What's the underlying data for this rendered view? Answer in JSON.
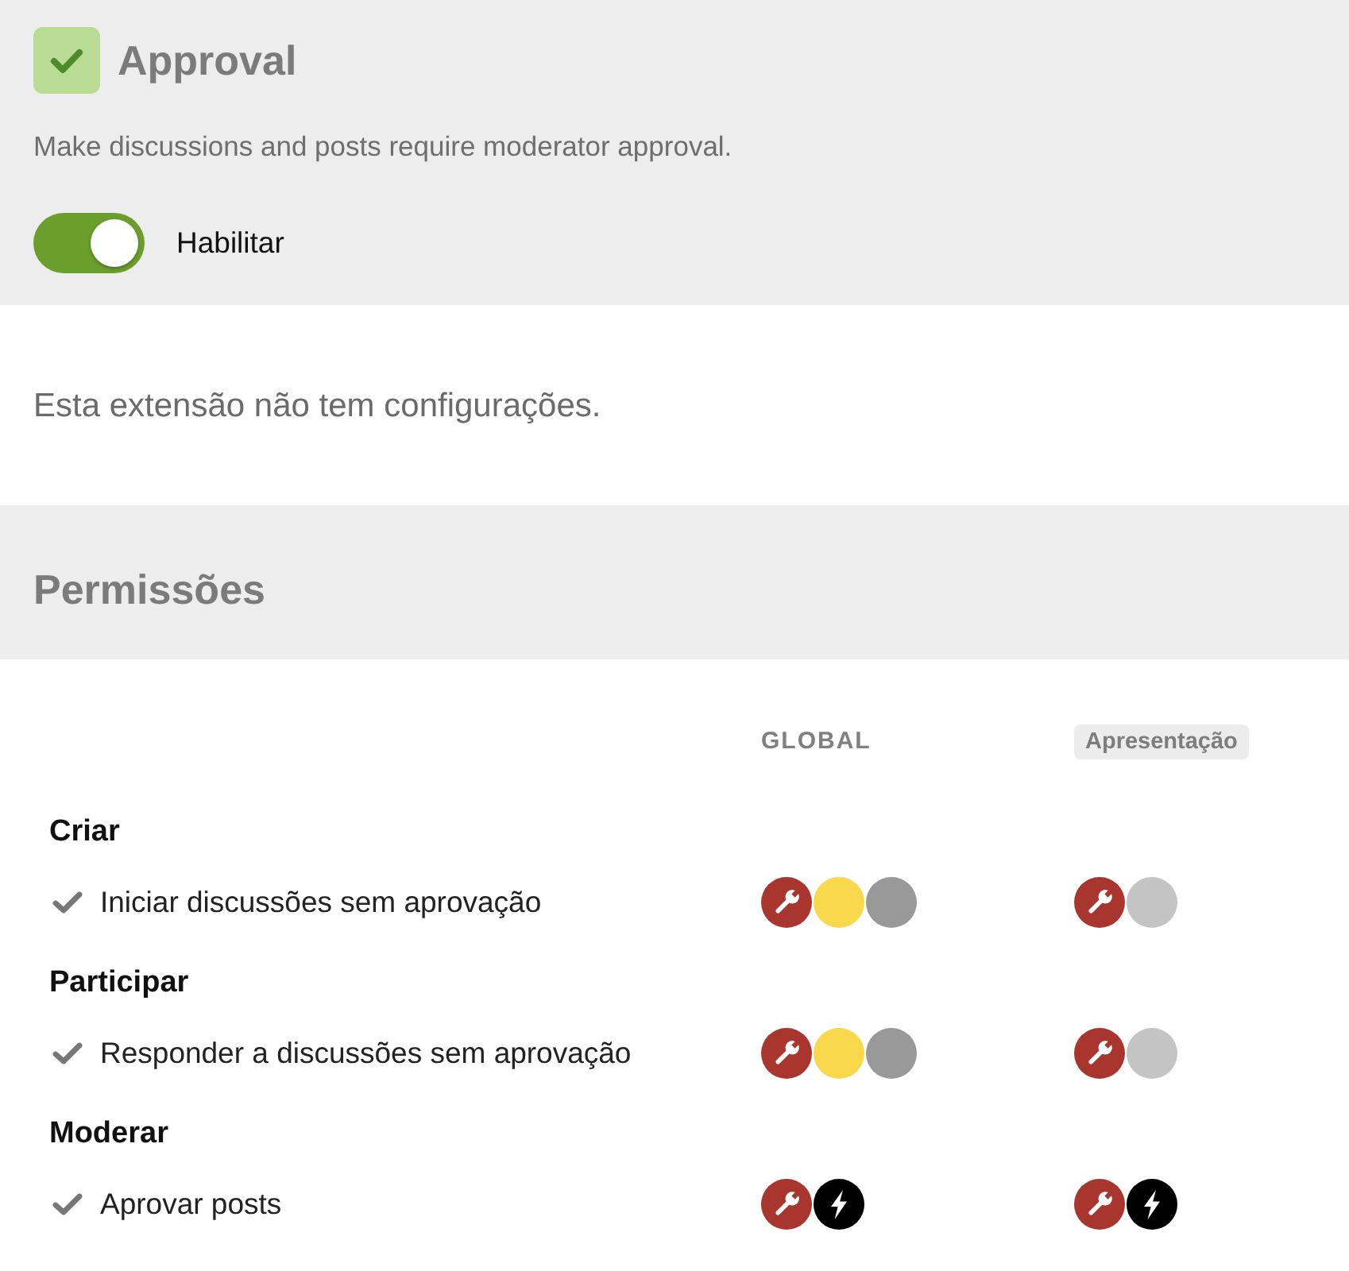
{
  "extension": {
    "title": "Approval",
    "description": "Make discussions and posts require moderator approval.",
    "toggle": {
      "label": "Habilitar",
      "on": true
    }
  },
  "settings": {
    "message": "Esta extensão não tem configurações."
  },
  "permissions": {
    "title": "Permissões",
    "columns": [
      {
        "label": "GLOBAL",
        "kind": "heading"
      },
      {
        "label": "Apresentação",
        "kind": "tag"
      }
    ],
    "groups": [
      {
        "title": "Criar",
        "items": [
          {
            "label": "Iniciar discussões sem aprovação",
            "cells": [
              {
                "badges": [
                  {
                    "kind": "wrench",
                    "color": "#a8352e"
                  },
                  {
                    "kind": "plain",
                    "color": "#fad84b"
                  },
                  {
                    "kind": "plain",
                    "color": "#999999"
                  }
                ]
              },
              {
                "badges": [
                  {
                    "kind": "wrench",
                    "color": "#a8352e"
                  },
                  {
                    "kind": "plain",
                    "color": "#c4c4c4"
                  }
                ]
              }
            ]
          }
        ]
      },
      {
        "title": "Participar",
        "items": [
          {
            "label": "Responder a discussões sem aprovação",
            "cells": [
              {
                "badges": [
                  {
                    "kind": "wrench",
                    "color": "#a8352e"
                  },
                  {
                    "kind": "plain",
                    "color": "#fad84b"
                  },
                  {
                    "kind": "plain",
                    "color": "#999999"
                  }
                ]
              },
              {
                "badges": [
                  {
                    "kind": "wrench",
                    "color": "#a8352e"
                  },
                  {
                    "kind": "plain",
                    "color": "#c4c4c4"
                  }
                ]
              }
            ]
          }
        ]
      },
      {
        "title": "Moderar",
        "items": [
          {
            "label": "Aprovar posts",
            "cells": [
              {
                "badges": [
                  {
                    "kind": "wrench",
                    "color": "#a8352e"
                  },
                  {
                    "kind": "bolt",
                    "color": "#000000"
                  }
                ]
              },
              {
                "badges": [
                  {
                    "kind": "wrench",
                    "color": "#a8352e"
                  },
                  {
                    "kind": "bolt",
                    "color": "#000000"
                  }
                ]
              }
            ]
          }
        ]
      }
    ]
  }
}
